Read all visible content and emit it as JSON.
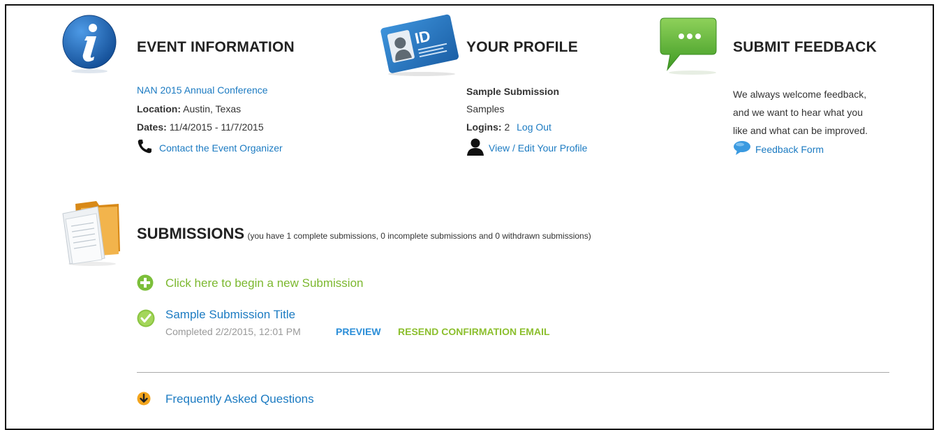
{
  "event": {
    "heading": "EVENT INFORMATION",
    "name": "NAN 2015 Annual Conference",
    "location_label": "Location:",
    "location_value": "Austin, Texas",
    "dates_label": "Dates:",
    "dates_value": "11/4/2015 - 11/7/2015",
    "contact_link": "Contact the Event Organizer",
    "icon": "info-icon"
  },
  "profile": {
    "heading": "YOUR PROFILE",
    "name": "Sample Submission",
    "org": "Samples",
    "logins_label": "Logins:",
    "logins_value": "2",
    "logout_link": "Log Out",
    "edit_link": "View / Edit Your Profile",
    "id_text": "ID",
    "icon": "id-card-icon"
  },
  "feedback": {
    "heading": "SUBMIT FEEDBACK",
    "line1": "We always welcome feedback,",
    "line2": "and we want to hear what you",
    "line3": "like and what can be improved.",
    "form_link": "Feedback Form",
    "icon": "chat-bubble-icon"
  },
  "submissions": {
    "heading": "SUBMISSIONS",
    "summary": "(you have 1 complete submissions, 0 incomplete submissions and 0 withdrawn submissions)",
    "new_link": "Click here to begin a new Submission",
    "items": [
      {
        "title": "Sample Submission Title",
        "status": "Completed 2/2/2015, 12:01 PM",
        "preview": "PREVIEW",
        "resend": "RESEND CONFIRMATION EMAIL"
      }
    ]
  },
  "faq": {
    "link": "Frequently Asked Questions"
  },
  "colors": {
    "link_blue": "#1c7bc2",
    "accent_green": "#7cb82f",
    "info_blue": "#1f66b6",
    "chat_green": "#5fae2e",
    "arrow_orange": "#f3a51d"
  }
}
